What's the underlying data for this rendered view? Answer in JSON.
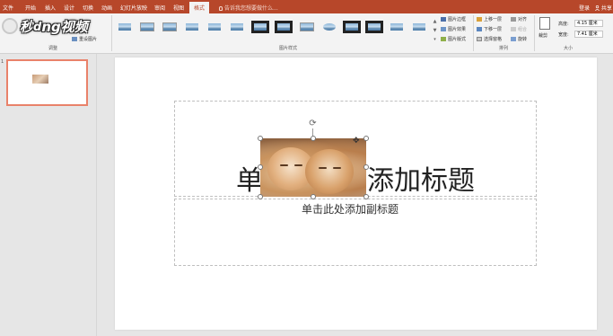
{
  "tabs": [
    "文件",
    "开始",
    "插入",
    "设计",
    "切换",
    "动画",
    "幻灯片放映",
    "审阅",
    "视图",
    "格式"
  ],
  "active_tab": "格式",
  "tell_me_placeholder": "告诉我您想要做什么...",
  "login_label": "登录",
  "share_label": "共享",
  "logo_text_left": "秒",
  "logo_text_o": "d",
  "logo_text_right": "ng视频",
  "ribbon": {
    "adjust_label": "调整",
    "picture_styles_label": "图片样式",
    "arrange_label": "排列",
    "size_label": "大小",
    "reset_picture": "重设图片",
    "picture_border": "图片边框",
    "picture_effects": "图片效果",
    "picture_layout": "图片版式",
    "bring_forward": "上移一层",
    "send_backward": "下移一层",
    "selection_pane": "选择窗格",
    "align": "对齐",
    "group": "组合",
    "rotate": "旋转",
    "crop": "裁剪",
    "height_label": "高度:",
    "height_value": "4.15 厘米",
    "width_label": "宽度:",
    "width_value": "7.41 厘米"
  },
  "slides_panel": {
    "slide_number": "1"
  },
  "slide": {
    "title_left": "单",
    "title_right": "添加标题",
    "subtitle": "单击此处添加副标题"
  }
}
